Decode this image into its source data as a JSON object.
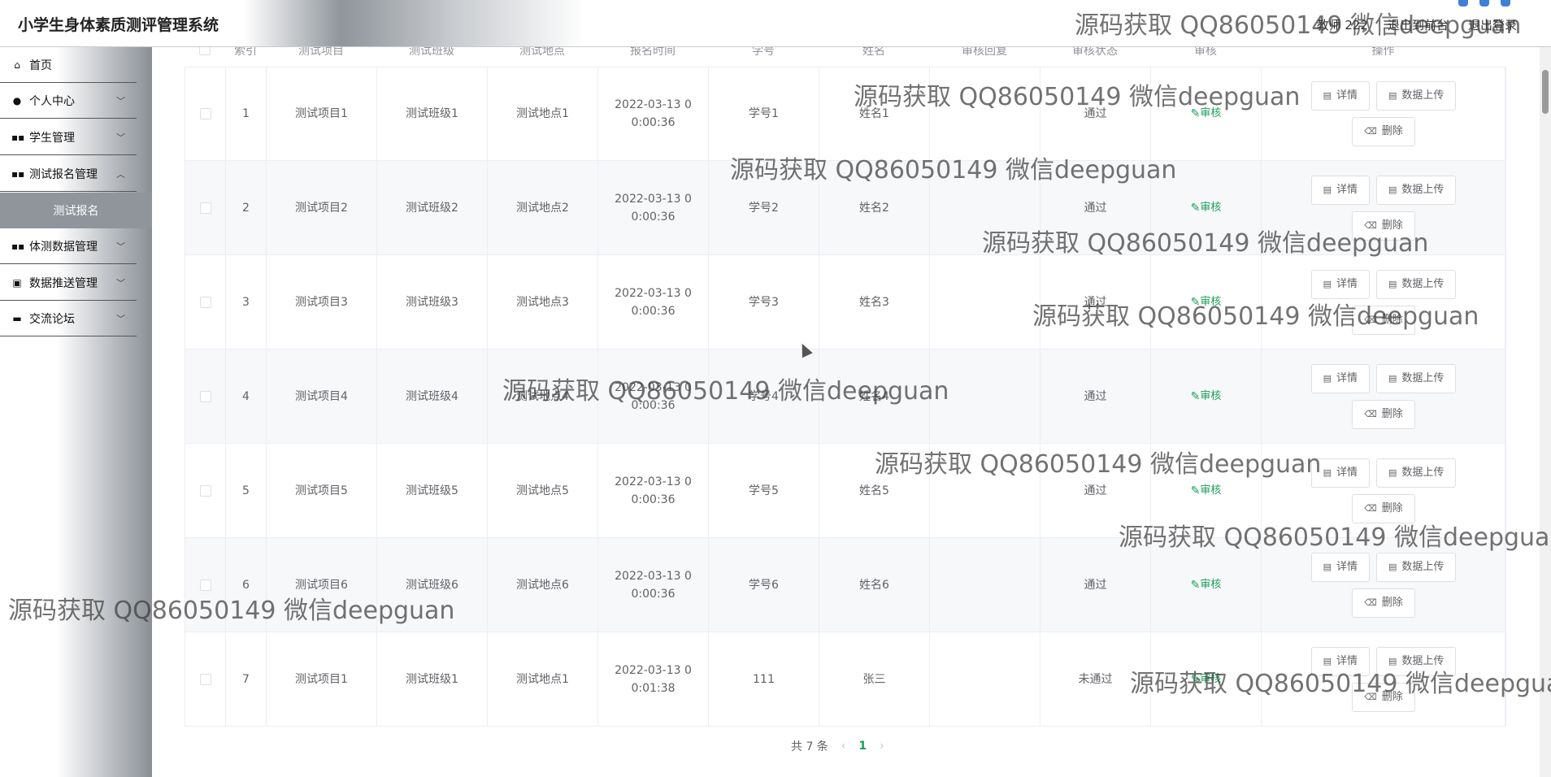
{
  "header": {
    "app_title": "小学生身体素质测评管理系统",
    "user_label": "教师 222",
    "back_link": "退出到前台",
    "logout": "退出登录"
  },
  "sidebar": {
    "items": [
      {
        "label": "首页",
        "icon": "home-icon",
        "expandable": false
      },
      {
        "label": "个人中心",
        "icon": "user-icon",
        "expandable": true
      },
      {
        "label": "学生管理",
        "icon": "grid-icon",
        "expandable": true
      },
      {
        "label": "测试报名管理",
        "icon": "grid-icon",
        "expandable": true
      },
      {
        "label": "测试报名",
        "icon": "",
        "expandable": false,
        "active_sub": true
      },
      {
        "label": "体测数据管理",
        "icon": "grid-icon",
        "expandable": true
      },
      {
        "label": "数据推送管理",
        "icon": "clipboard-icon",
        "expandable": true
      },
      {
        "label": "交流论坛",
        "icon": "message-icon",
        "expandable": true
      }
    ]
  },
  "table": {
    "headers": [
      "索引",
      "测试项目",
      "测试班级",
      "测试地点",
      "报名时间",
      "学号",
      "姓名",
      "审核回复",
      "审核状态",
      "审核",
      "操作"
    ],
    "rows": [
      {
        "index": "1",
        "project": "测试项目1",
        "class": "测试班级1",
        "place": "测试地点1",
        "time": "2022-03-13 00:00:36",
        "sid": "学号1",
        "name": "姓名1",
        "reply": "",
        "status": "通过",
        "audit": "审核"
      },
      {
        "index": "2",
        "project": "测试项目2",
        "class": "测试班级2",
        "place": "测试地点2",
        "time": "2022-03-13 00:00:36",
        "sid": "学号2",
        "name": "姓名2",
        "reply": "",
        "status": "通过",
        "audit": "审核"
      },
      {
        "index": "3",
        "project": "测试项目3",
        "class": "测试班级3",
        "place": "测试地点3",
        "time": "2022-03-13 00:00:36",
        "sid": "学号3",
        "name": "姓名3",
        "reply": "",
        "status": "通过",
        "audit": "审核"
      },
      {
        "index": "4",
        "project": "测试项目4",
        "class": "测试班级4",
        "place": "测试地点4",
        "time": "2022-03-13 00:00:36",
        "sid": "学号4",
        "name": "姓名4",
        "reply": "",
        "status": "通过",
        "audit": "审核"
      },
      {
        "index": "5",
        "project": "测试项目5",
        "class": "测试班级5",
        "place": "测试地点5",
        "time": "2022-03-13 00:00:36",
        "sid": "学号5",
        "name": "姓名5",
        "reply": "",
        "status": "通过",
        "audit": "审核"
      },
      {
        "index": "6",
        "project": "测试项目6",
        "class": "测试班级6",
        "place": "测试地点6",
        "time": "2022-03-13 00:00:36",
        "sid": "学号6",
        "name": "姓名6",
        "reply": "",
        "status": "通过",
        "audit": "审核"
      },
      {
        "index": "7",
        "project": "测试项目1",
        "class": "测试班级1",
        "place": "测试地点1",
        "time": "2022-03-13 00:01:38",
        "sid": "111",
        "name": "张三",
        "reply": "",
        "status": "未通过",
        "audit": "审核"
      }
    ],
    "buttons": {
      "detail": "详情",
      "upload": "数据上传",
      "delete": "删除"
    }
  },
  "pagination": {
    "total": "共 7 条",
    "current": "1"
  },
  "watermark": "源码获取 QQ86050149 微信deepguan",
  "colors": {
    "accent": "#18a058",
    "sidebar_active": "#8f959b"
  }
}
